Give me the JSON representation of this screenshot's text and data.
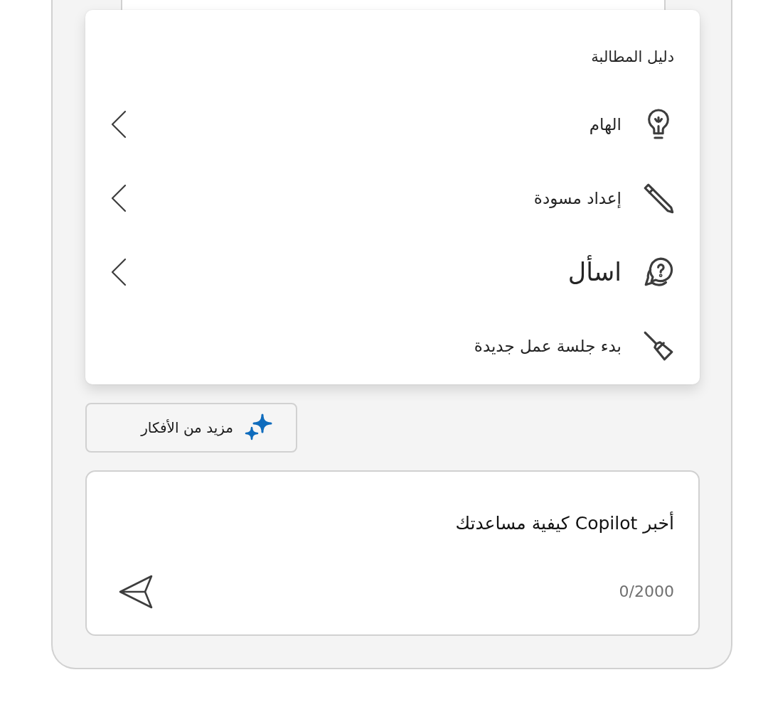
{
  "prompt_guide": {
    "title": "دليل المطالبة",
    "items": [
      {
        "kind": "inspire",
        "label": "الهام",
        "submenu": true,
        "emphasized": false
      },
      {
        "kind": "draft",
        "label": "إعداد مسودة",
        "submenu": true,
        "emphasized": false
      },
      {
        "kind": "ask",
        "label": "اسأل",
        "submenu": true,
        "emphasized": true
      },
      {
        "kind": "reset",
        "label": "بدء جلسة عمل جديدة",
        "submenu": false,
        "emphasized": false
      }
    ]
  },
  "more_ideas_button": {
    "label": "مزيد من الأفكار"
  },
  "composer": {
    "placeholder": "أخبر Copilot كيفية مساعدتك",
    "counter": "0/2000"
  }
}
